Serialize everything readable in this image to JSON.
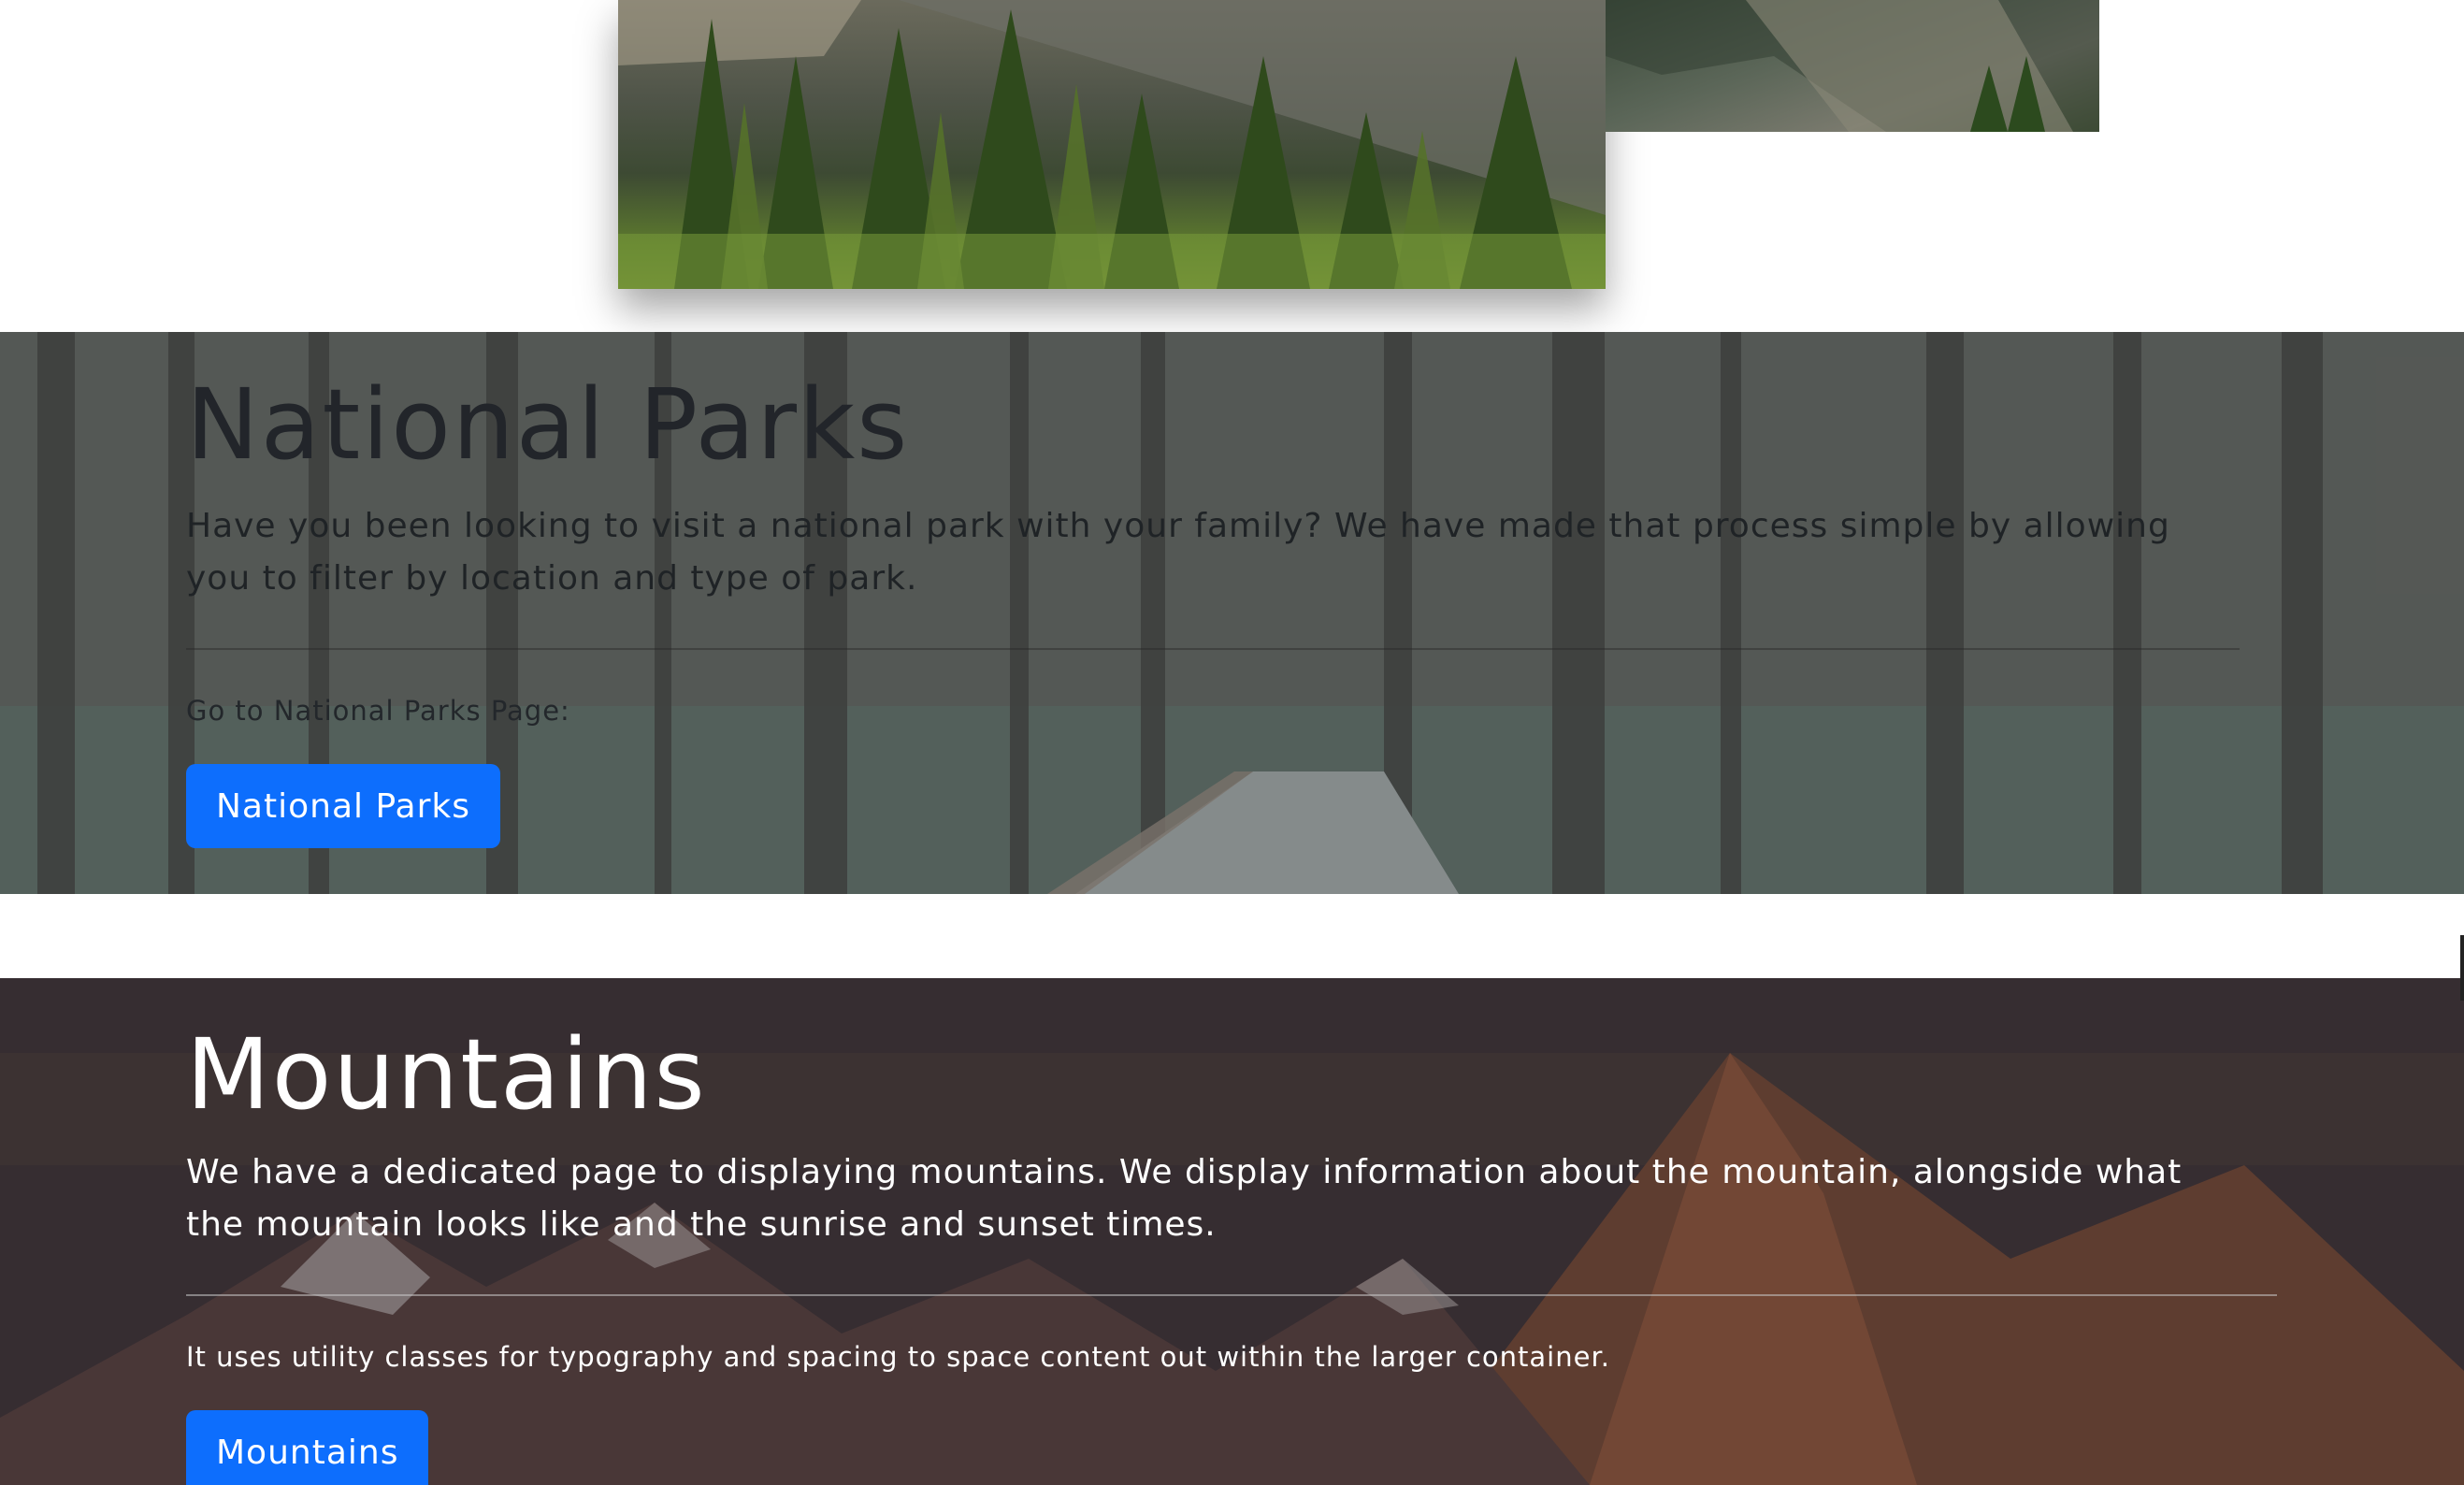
{
  "national_parks": {
    "title": "National Parks",
    "description": "Have you been looking to visit a national park with your family? We have made that process simple by allowing you to filter by location and type of park.",
    "subtext": "Go to National Parks Page:",
    "button_label": "National Parks"
  },
  "mountains": {
    "title": "Mountains",
    "description": "We have a dedicated page to displaying mountains. We display information about the mountain, alongside what the mountain looks like and the sunrise and sunset times.",
    "subtext": "It uses utility classes for typography and spacing to space content out within the larger container.",
    "button_label": "Mountains"
  },
  "colors": {
    "button_primary": "#0d6efd",
    "parks_overlay": "#5d5f5c",
    "mountains_overlay": "#3a3136"
  },
  "images": {
    "top_photo_a": "forest-trees-photo",
    "top_photo_b": "cliff-photo",
    "parks_background": "forest-road-photo",
    "mountains_background": "mountain-range-photo"
  }
}
